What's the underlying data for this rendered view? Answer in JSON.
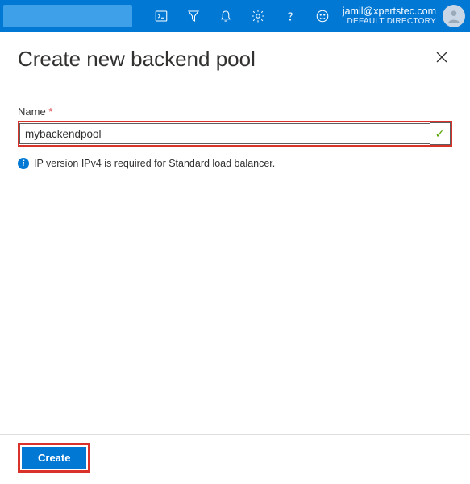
{
  "topbar": {
    "user_email": "jamil@xpertstec.com",
    "directory_label": "DEFAULT DIRECTORY"
  },
  "panel": {
    "title": "Create new backend pool",
    "name_label": "Name",
    "name_value": "mybackendpool",
    "info_text": "IP version IPv4 is required for Standard load balancer."
  },
  "footer": {
    "create_label": "Create"
  }
}
